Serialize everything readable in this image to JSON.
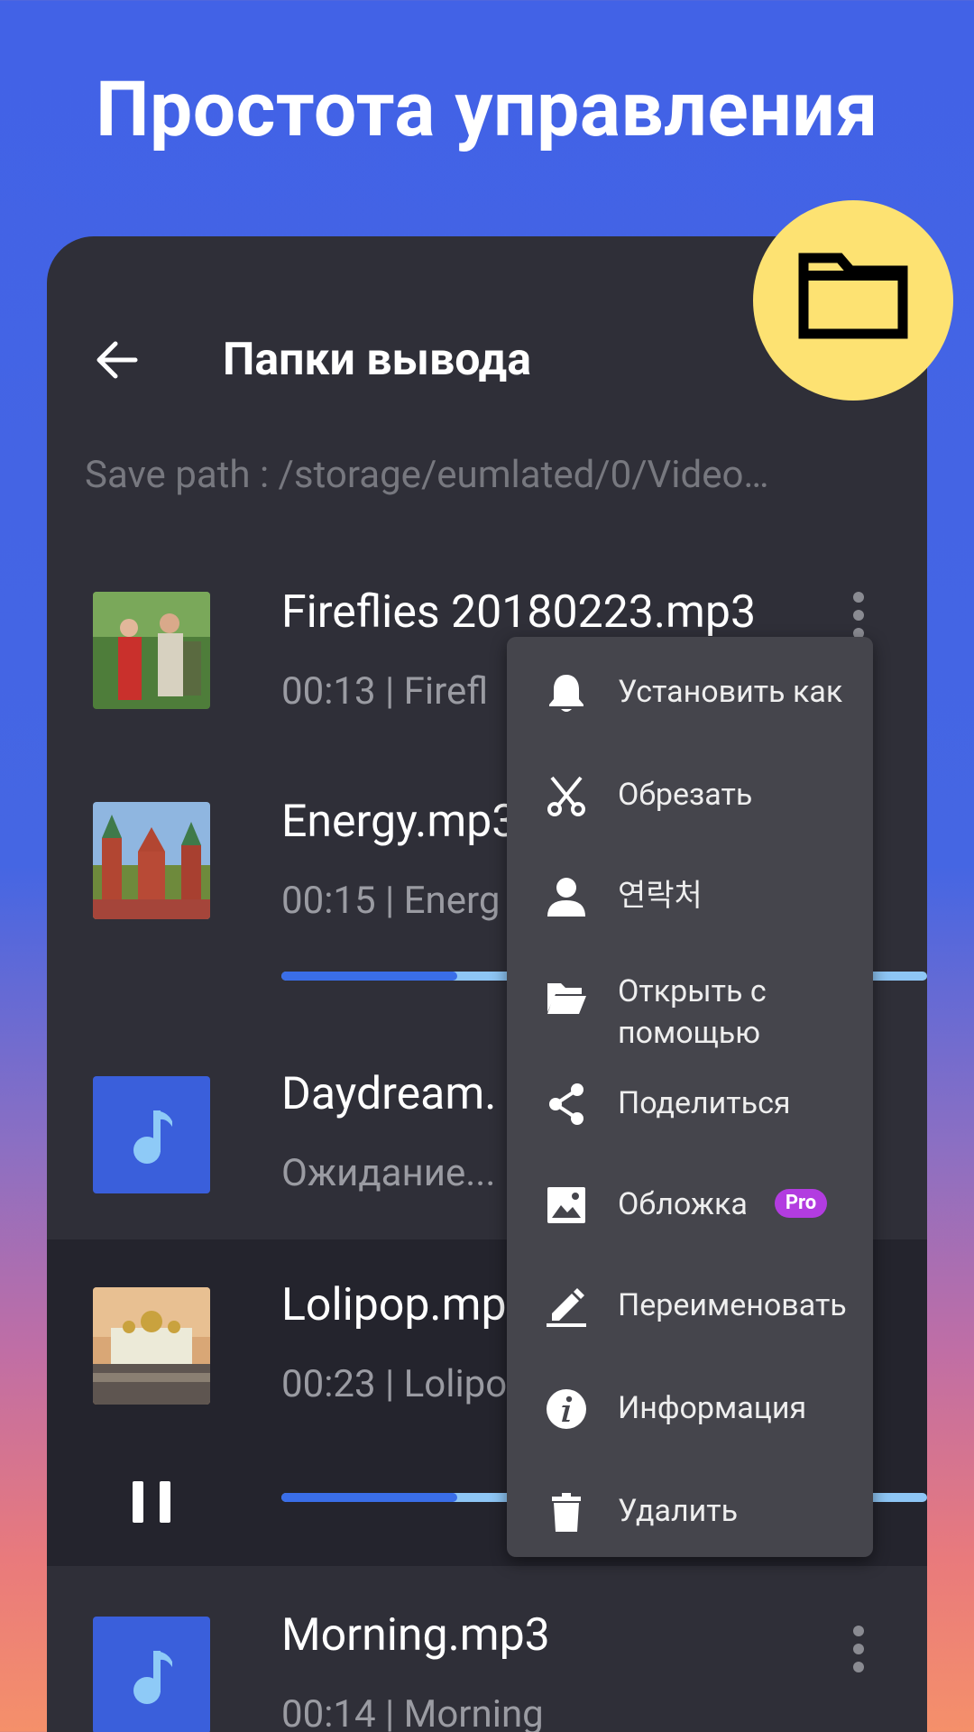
{
  "headline": "Простота управления",
  "appbar": {
    "title": "Папки вывода"
  },
  "save_path": "Save path : /storage/eumlated/0/Video…",
  "tracks": [
    {
      "name": "Fireflies 20180223.mp3",
      "sub": "00:13 | Firefl"
    },
    {
      "name": "Energy.mp3",
      "sub": "00:15 | Energ"
    },
    {
      "name": "Daydream.",
      "sub": "Ожидание..."
    },
    {
      "name": "Lolipop.mp",
      "sub": "00:23 | Lolipo"
    },
    {
      "name": "Morning.mp3",
      "sub": "00:14 | Morning"
    }
  ],
  "menu": {
    "items": [
      {
        "label": "Установить как",
        "icon": "bell-icon"
      },
      {
        "label": "Обрезать",
        "icon": "scissors-icon"
      },
      {
        "label": "연락처",
        "icon": "person-icon"
      },
      {
        "label_line1": "Открыть с",
        "label_line2": "помощью",
        "icon": "folder-open-icon"
      },
      {
        "label": "Поделиться",
        "icon": "share-icon"
      },
      {
        "label": "Обложка",
        "icon": "image-icon",
        "badge": "Pro"
      },
      {
        "label": "Переименовать",
        "icon": "pencil-icon"
      },
      {
        "label": "Информация",
        "icon": "info-icon"
      },
      {
        "label": "Удалить",
        "icon": "trash-icon"
      }
    ]
  },
  "colors": {
    "accent": "#3a6ee8",
    "progress_track": "#8ec6f5",
    "badge_yellow": "#fde272",
    "pro_badge": "#b23ce0"
  }
}
